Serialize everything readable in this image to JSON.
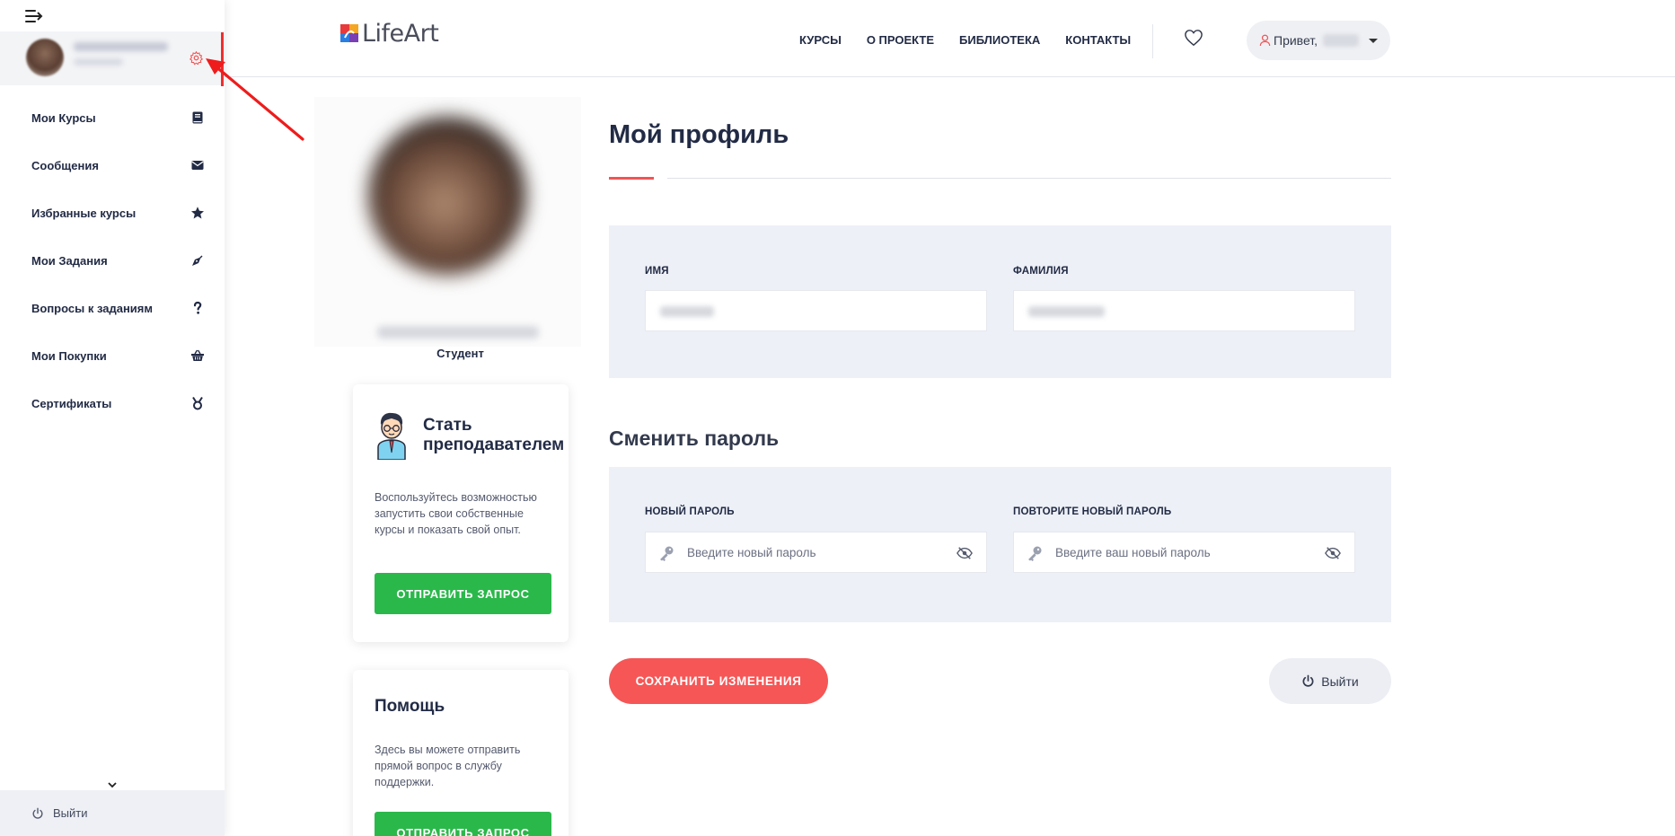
{
  "sidebar": {
    "items": [
      {
        "label": "Мои Курсы",
        "icon": "book-icon"
      },
      {
        "label": "Сообщения",
        "icon": "envelope-icon"
      },
      {
        "label": "Избранные курсы",
        "icon": "star-icon"
      },
      {
        "label": "Мои Задания",
        "icon": "pen-nib-icon"
      },
      {
        "label": "Вопросы к заданиям",
        "icon": "question-icon"
      },
      {
        "label": "Мои Покупки",
        "icon": "basket-icon"
      },
      {
        "label": "Сертификаты",
        "icon": "medal-icon"
      }
    ],
    "logout_label": "Выйти"
  },
  "header": {
    "logo_text": "LifeArt",
    "nav": [
      "КУРСЫ",
      "О ПРОЕКТЕ",
      "БИБЛИОТЕКА",
      "КОНТАКТЫ"
    ],
    "greeting": "Привет,"
  },
  "profile": {
    "role": "Студент"
  },
  "teacher_card": {
    "title": "Стать преподавателем",
    "text": "Воспользуйтесь возможностью запустить свои собственные курсы и показать свой опыт.",
    "button": "ОТПРАВИТЬ ЗАПРОС"
  },
  "help_card": {
    "title": "Помощь",
    "text": "Здесь вы можете отправить прямой вопрос в службу поддержки.",
    "button": "ОТПРАВИТЬ ЗАПРОС"
  },
  "main": {
    "title": "Мой профиль",
    "first_name_label": "ИМЯ",
    "last_name_label": "ФАМИЛИЯ",
    "change_password_title": "Сменить пароль",
    "new_password_label": "НОВЫЙ ПАРОЛЬ",
    "new_password_placeholder": "Введите новый пароль",
    "repeat_password_label": "ПОВТОРИТЕ НОВЫЙ ПАРОЛЬ",
    "repeat_password_placeholder": "Введите ваш новый пароль",
    "save_button": "СОХРАНИТЬ ИЗМЕНЕНИЯ",
    "logout_button": "Выйти"
  },
  "colors": {
    "accent_red": "#f65656",
    "green": "#2bb84b",
    "panel_bg": "#edf0f7",
    "text_dark": "#222b45"
  }
}
